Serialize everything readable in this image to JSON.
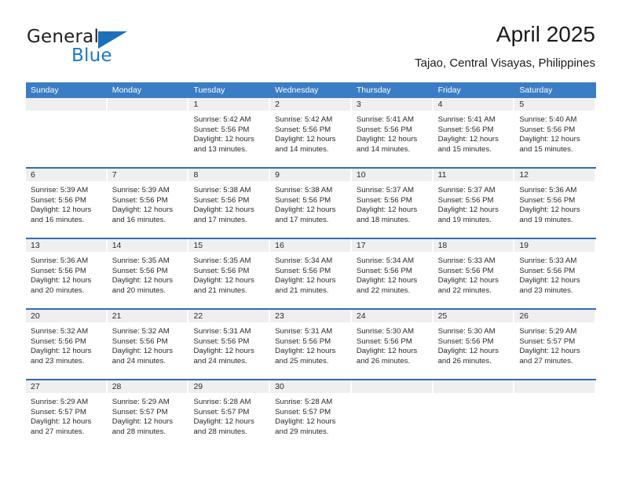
{
  "brand": {
    "name_part1": "General",
    "name_part2": "Blue",
    "triangle_icon": "triangle-icon",
    "accent_color": "#1878c8"
  },
  "header": {
    "title": "April 2025",
    "subtitle": "Tajao, Central Visayas, Philippines"
  },
  "colors": {
    "header_blue": "#3b7dc4",
    "row_divider_blue": "#2f6eb5",
    "day_strip_gray": "#efefef",
    "text": "#2a2a2a"
  },
  "calendar": {
    "weekdays": [
      "Sunday",
      "Monday",
      "Tuesday",
      "Wednesday",
      "Thursday",
      "Friday",
      "Saturday"
    ],
    "weeks": [
      [
        {
          "day": "",
          "empty": true
        },
        {
          "day": "",
          "empty": true
        },
        {
          "day": "1",
          "sunrise": "Sunrise: 5:42 AM",
          "sunset": "Sunset: 5:56 PM",
          "daylight1": "Daylight: 12 hours",
          "daylight2": "and 13 minutes."
        },
        {
          "day": "2",
          "sunrise": "Sunrise: 5:42 AM",
          "sunset": "Sunset: 5:56 PM",
          "daylight1": "Daylight: 12 hours",
          "daylight2": "and 14 minutes."
        },
        {
          "day": "3",
          "sunrise": "Sunrise: 5:41 AM",
          "sunset": "Sunset: 5:56 PM",
          "daylight1": "Daylight: 12 hours",
          "daylight2": "and 14 minutes."
        },
        {
          "day": "4",
          "sunrise": "Sunrise: 5:41 AM",
          "sunset": "Sunset: 5:56 PM",
          "daylight1": "Daylight: 12 hours",
          "daylight2": "and 15 minutes."
        },
        {
          "day": "5",
          "sunrise": "Sunrise: 5:40 AM",
          "sunset": "Sunset: 5:56 PM",
          "daylight1": "Daylight: 12 hours",
          "daylight2": "and 15 minutes."
        }
      ],
      [
        {
          "day": "6",
          "sunrise": "Sunrise: 5:39 AM",
          "sunset": "Sunset: 5:56 PM",
          "daylight1": "Daylight: 12 hours",
          "daylight2": "and 16 minutes."
        },
        {
          "day": "7",
          "sunrise": "Sunrise: 5:39 AM",
          "sunset": "Sunset: 5:56 PM",
          "daylight1": "Daylight: 12 hours",
          "daylight2": "and 16 minutes."
        },
        {
          "day": "8",
          "sunrise": "Sunrise: 5:38 AM",
          "sunset": "Sunset: 5:56 PM",
          "daylight1": "Daylight: 12 hours",
          "daylight2": "and 17 minutes."
        },
        {
          "day": "9",
          "sunrise": "Sunrise: 5:38 AM",
          "sunset": "Sunset: 5:56 PM",
          "daylight1": "Daylight: 12 hours",
          "daylight2": "and 17 minutes."
        },
        {
          "day": "10",
          "sunrise": "Sunrise: 5:37 AM",
          "sunset": "Sunset: 5:56 PM",
          "daylight1": "Daylight: 12 hours",
          "daylight2": "and 18 minutes."
        },
        {
          "day": "11",
          "sunrise": "Sunrise: 5:37 AM",
          "sunset": "Sunset: 5:56 PM",
          "daylight1": "Daylight: 12 hours",
          "daylight2": "and 19 minutes."
        },
        {
          "day": "12",
          "sunrise": "Sunrise: 5:36 AM",
          "sunset": "Sunset: 5:56 PM",
          "daylight1": "Daylight: 12 hours",
          "daylight2": "and 19 minutes."
        }
      ],
      [
        {
          "day": "13",
          "sunrise": "Sunrise: 5:36 AM",
          "sunset": "Sunset: 5:56 PM",
          "daylight1": "Daylight: 12 hours",
          "daylight2": "and 20 minutes."
        },
        {
          "day": "14",
          "sunrise": "Sunrise: 5:35 AM",
          "sunset": "Sunset: 5:56 PM",
          "daylight1": "Daylight: 12 hours",
          "daylight2": "and 20 minutes."
        },
        {
          "day": "15",
          "sunrise": "Sunrise: 5:35 AM",
          "sunset": "Sunset: 5:56 PM",
          "daylight1": "Daylight: 12 hours",
          "daylight2": "and 21 minutes."
        },
        {
          "day": "16",
          "sunrise": "Sunrise: 5:34 AM",
          "sunset": "Sunset: 5:56 PM",
          "daylight1": "Daylight: 12 hours",
          "daylight2": "and 21 minutes."
        },
        {
          "day": "17",
          "sunrise": "Sunrise: 5:34 AM",
          "sunset": "Sunset: 5:56 PM",
          "daylight1": "Daylight: 12 hours",
          "daylight2": "and 22 minutes."
        },
        {
          "day": "18",
          "sunrise": "Sunrise: 5:33 AM",
          "sunset": "Sunset: 5:56 PM",
          "daylight1": "Daylight: 12 hours",
          "daylight2": "and 22 minutes."
        },
        {
          "day": "19",
          "sunrise": "Sunrise: 5:33 AM",
          "sunset": "Sunset: 5:56 PM",
          "daylight1": "Daylight: 12 hours",
          "daylight2": "and 23 minutes."
        }
      ],
      [
        {
          "day": "20",
          "sunrise": "Sunrise: 5:32 AM",
          "sunset": "Sunset: 5:56 PM",
          "daylight1": "Daylight: 12 hours",
          "daylight2": "and 23 minutes."
        },
        {
          "day": "21",
          "sunrise": "Sunrise: 5:32 AM",
          "sunset": "Sunset: 5:56 PM",
          "daylight1": "Daylight: 12 hours",
          "daylight2": "and 24 minutes."
        },
        {
          "day": "22",
          "sunrise": "Sunrise: 5:31 AM",
          "sunset": "Sunset: 5:56 PM",
          "daylight1": "Daylight: 12 hours",
          "daylight2": "and 24 minutes."
        },
        {
          "day": "23",
          "sunrise": "Sunrise: 5:31 AM",
          "sunset": "Sunset: 5:56 PM",
          "daylight1": "Daylight: 12 hours",
          "daylight2": "and 25 minutes."
        },
        {
          "day": "24",
          "sunrise": "Sunrise: 5:30 AM",
          "sunset": "Sunset: 5:56 PM",
          "daylight1": "Daylight: 12 hours",
          "daylight2": "and 26 minutes."
        },
        {
          "day": "25",
          "sunrise": "Sunrise: 5:30 AM",
          "sunset": "Sunset: 5:56 PM",
          "daylight1": "Daylight: 12 hours",
          "daylight2": "and 26 minutes."
        },
        {
          "day": "26",
          "sunrise": "Sunrise: 5:29 AM",
          "sunset": "Sunset: 5:57 PM",
          "daylight1": "Daylight: 12 hours",
          "daylight2": "and 27 minutes."
        }
      ],
      [
        {
          "day": "27",
          "sunrise": "Sunrise: 5:29 AM",
          "sunset": "Sunset: 5:57 PM",
          "daylight1": "Daylight: 12 hours",
          "daylight2": "and 27 minutes."
        },
        {
          "day": "28",
          "sunrise": "Sunrise: 5:29 AM",
          "sunset": "Sunset: 5:57 PM",
          "daylight1": "Daylight: 12 hours",
          "daylight2": "and 28 minutes."
        },
        {
          "day": "29",
          "sunrise": "Sunrise: 5:28 AM",
          "sunset": "Sunset: 5:57 PM",
          "daylight1": "Daylight: 12 hours",
          "daylight2": "and 28 minutes."
        },
        {
          "day": "30",
          "sunrise": "Sunrise: 5:28 AM",
          "sunset": "Sunset: 5:57 PM",
          "daylight1": "Daylight: 12 hours",
          "daylight2": "and 29 minutes."
        },
        {
          "day": "",
          "empty": true
        },
        {
          "day": "",
          "empty": true
        },
        {
          "day": "",
          "empty": true
        }
      ]
    ]
  }
}
